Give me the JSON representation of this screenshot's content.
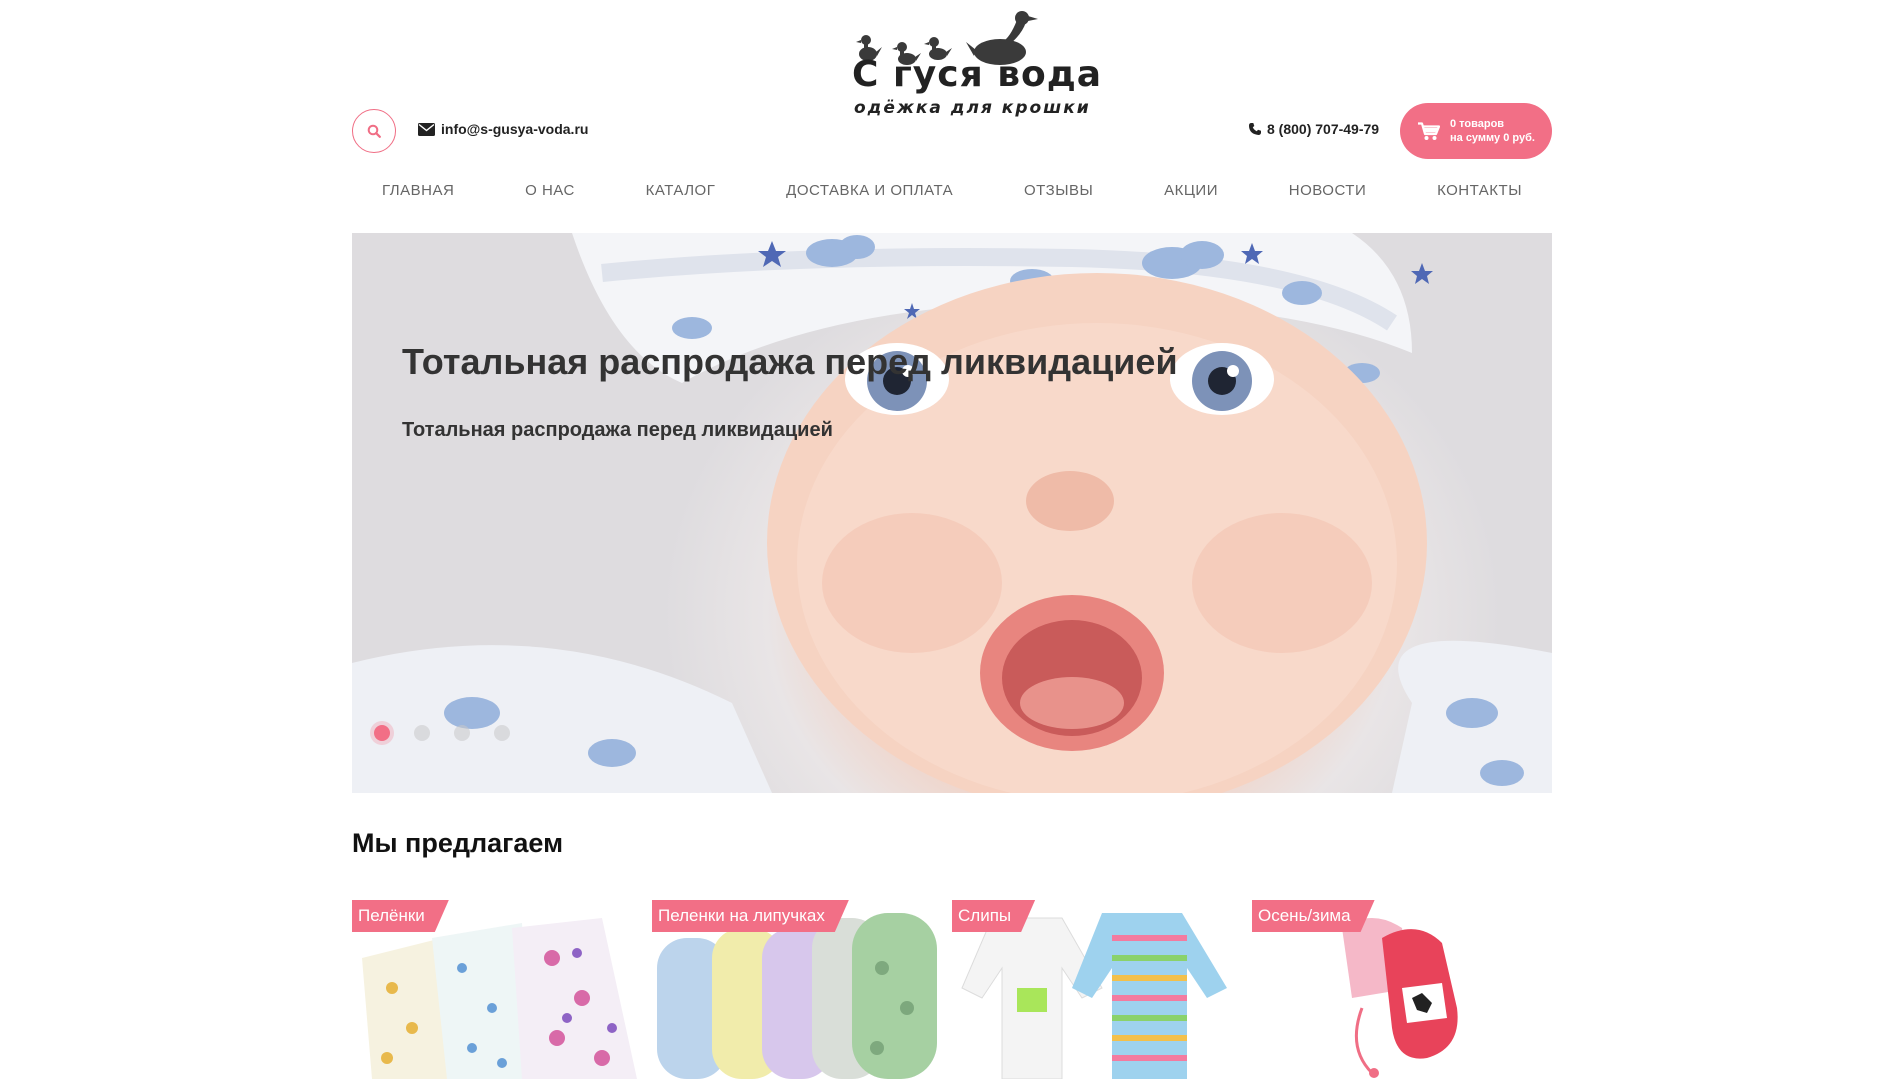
{
  "brand": {
    "name_line1": "С гуся вода",
    "name_line2": "одёжка для крошки"
  },
  "header": {
    "email": "info@s-gusya-voda.ru",
    "phone": "8 (800) 707-49-79",
    "cart": {
      "line1": "0 товаров",
      "line2": "на сумму 0 руб."
    },
    "accent_color": "#f26f86"
  },
  "nav": {
    "items": [
      "ГЛАВНАЯ",
      "О НАС",
      "КАТАЛОГ",
      "ДОСТАВКА И ОПЛАТА",
      "ОТЗЫВЫ",
      "АКЦИИ",
      "НОВОСТИ",
      "КОНТАКТЫ"
    ]
  },
  "hero": {
    "title": "Тотальная распродажа перед ликвидацией",
    "subtitle": "Тотальная распродажа перед ликвидацией",
    "slide_count": 4,
    "active_slide": 1
  },
  "offers": {
    "title": "Мы предлагаем",
    "cards": [
      {
        "label": "Пелёнки"
      },
      {
        "label": "Пеленки на липучках"
      },
      {
        "label": "Слипы"
      },
      {
        "label": "Осень/зима"
      }
    ]
  }
}
